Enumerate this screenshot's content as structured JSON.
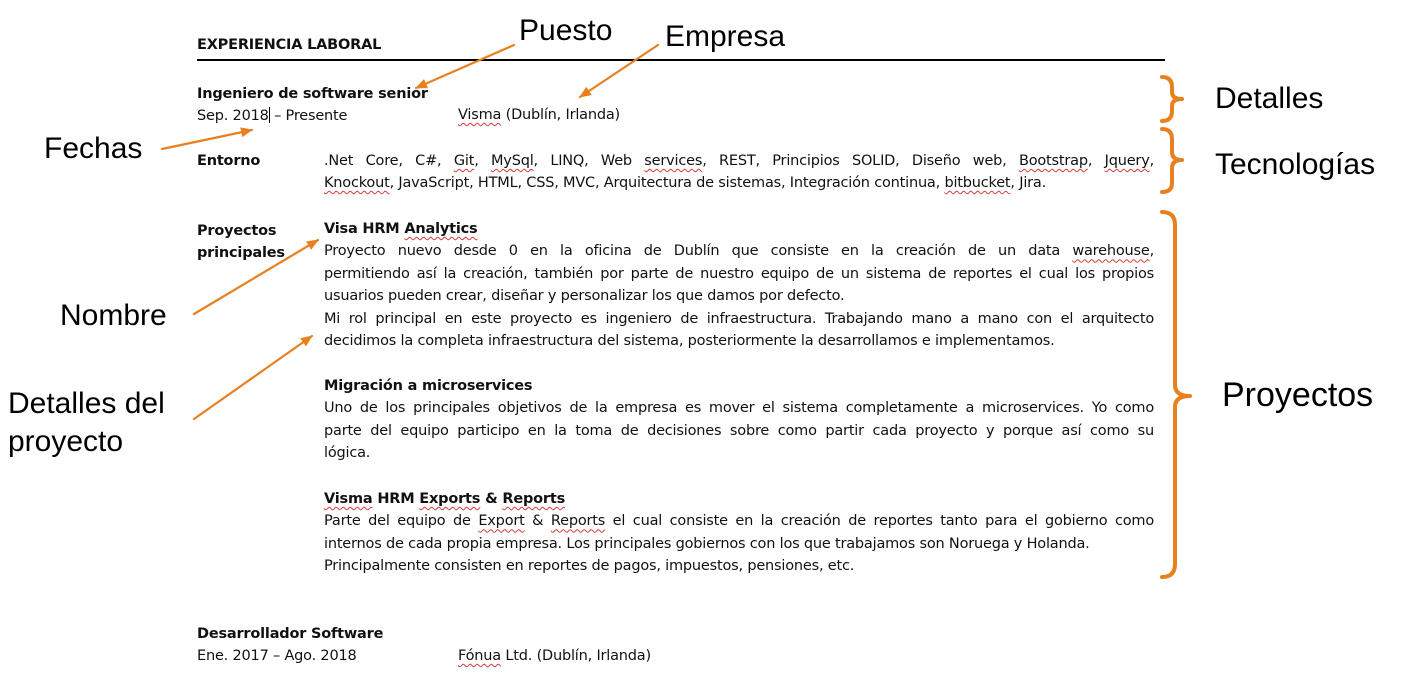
{
  "section_title": "EXPERIENCIA LABORAL",
  "job1": {
    "title": "Ingeniero de software senior",
    "dates_a": "Sep. 2018",
    "dates_b": " – Presente",
    "company": "Visma",
    "location": " (Dublín, Irlanda)"
  },
  "environment": {
    "label": "Entorno",
    "line1": [
      {
        "t": ".Net Core, C#, ",
        "sq": false
      },
      {
        "t": "Git",
        "sq": true
      },
      {
        "t": ", ",
        "sq": false
      },
      {
        "t": "MySql",
        "sq": true
      },
      {
        "t": ", LINQ, Web ",
        "sq": false
      },
      {
        "t": "services",
        "sq": true
      },
      {
        "t": ", REST, Principios SOLID, Diseño web, ",
        "sq": false
      },
      {
        "t": "Bootstrap",
        "sq": true
      },
      {
        "t": ", ",
        "sq": false
      },
      {
        "t": "Jquery",
        "sq": true
      },
      {
        "t": ",",
        "sq": false
      }
    ],
    "line2": [
      {
        "t": "Knockout",
        "sq": true
      },
      {
        "t": ", JavaScript, HTML, CSS, MVC, Arquitectura de sistemas,  Integración continua, ",
        "sq": false
      },
      {
        "t": "bitbucket",
        "sq": true
      },
      {
        "t": ", Jira.",
        "sq": false
      }
    ]
  },
  "projects_label_1": "Proyectos",
  "projects_label_2": "principales",
  "projects": [
    {
      "title": [
        {
          "t": "Visa HRM ",
          "sq": false
        },
        {
          "t": "Analytics",
          "sq": true
        }
      ],
      "lines": [
        [
          {
            "t": "Proyecto nuevo desde 0 en la oficina de Dublín que consiste en la creación de un data ",
            "sq": false
          },
          {
            "t": "warehouse",
            "sq": true
          },
          {
            "t": ",",
            "sq": false
          }
        ],
        [
          {
            "t": "permitiendo así la creación, también por parte de nuestro equipo de un sistema de reportes el cual los propios",
            "sq": false
          }
        ],
        [
          {
            "t": "usuarios pueden crear, diseñar y personalizar los que damos por defecto.",
            "sq": false
          }
        ],
        [
          {
            "t": "Mi rol principal en este proyecto es ingeniero de infraestructura. Trabajando mano a mano con el arquitecto",
            "sq": false
          }
        ],
        [
          {
            "t": "decidimos la completa infraestructura del sistema, posteriormente la desarrollamos e implementamos.",
            "sq": false
          }
        ]
      ],
      "justify": [
        true,
        true,
        false,
        true,
        false
      ]
    },
    {
      "title": [
        {
          "t": "Migración a microservices",
          "sq": false
        }
      ],
      "lines": [
        [
          {
            "t": "Uno de los principales objetivos de la empresa es mover el sistema completamente a microservices. Yo como",
            "sq": false
          }
        ],
        [
          {
            "t": "parte del equipo participo en la toma de decisiones sobre como partir cada proyecto y porque así como su",
            "sq": false
          }
        ],
        [
          {
            "t": "lógica.",
            "sq": false
          }
        ]
      ],
      "justify": [
        true,
        true,
        false
      ]
    },
    {
      "title": [
        {
          "t": "Visma",
          "sq": true
        },
        {
          "t": " HRM ",
          "sq": false
        },
        {
          "t": "Exports",
          "sq": true
        },
        {
          "t": " & ",
          "sq": false
        },
        {
          "t": "Reports",
          "sq": true
        }
      ],
      "lines": [
        [
          {
            "t": "Parte del equipo de ",
            "sq": false
          },
          {
            "t": "Export",
            "sq": true
          },
          {
            "t": " & ",
            "sq": false
          },
          {
            "t": "Reports",
            "sq": true
          },
          {
            "t": " el cual consiste en la creación de reportes tanto para el gobierno como",
            "sq": false
          }
        ],
        [
          {
            "t": "internos de cada propia empresa. Los principales gobiernos con los que trabajamos son Noruega y Holanda.",
            "sq": false
          }
        ],
        [
          {
            "t": "Principalmente consisten en reportes de pagos, impuestos, pensiones, etc.",
            "sq": false
          }
        ]
      ],
      "justify": [
        true,
        false,
        false
      ]
    }
  ],
  "job2": {
    "title": "Desarrollador Software",
    "dates": "Ene. 2017 – Ago. 2018",
    "company": "Fónua",
    "location": " Ltd. (Dublín, Irlanda)"
  },
  "annotations": {
    "puesto": "Puesto",
    "empresa": "Empresa",
    "fechas": "Fechas",
    "detalles": "Detalles",
    "tecnologias": "Tecnologías",
    "nombre": "Nombre",
    "detalles_proyecto_1": "Detalles del",
    "detalles_proyecto_2": "proyecto",
    "proyectos": "Proyectos"
  },
  "colors": {
    "accent_orange": "#e8801f",
    "squiggle_red": "#d83a3a"
  }
}
